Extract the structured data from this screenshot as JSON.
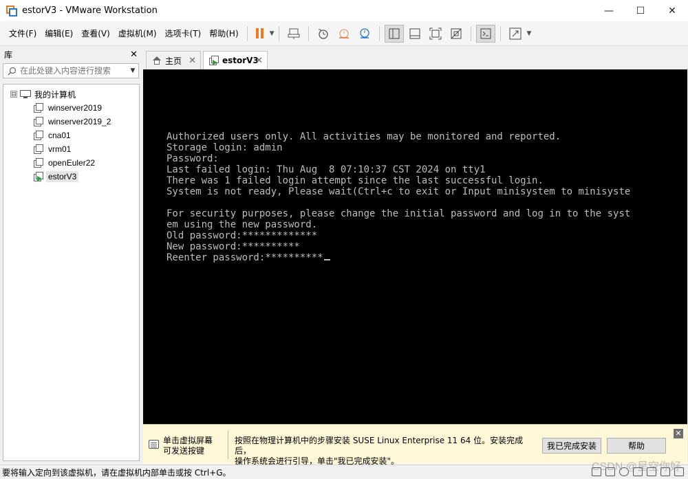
{
  "window": {
    "title": "estorV3 - VMware Workstation",
    "controls": {
      "minimize": "—",
      "maximize": "☐",
      "close": "✕"
    }
  },
  "menu": {
    "items": [
      "文件(F)",
      "编辑(E)",
      "查看(V)",
      "虚拟机(M)",
      "选项卡(T)",
      "帮助(H)"
    ]
  },
  "toolbar": {
    "pause_color": "#f07a1c",
    "icons": [
      "send-ctrl-alt-del-icon",
      "snapshot-icon",
      "revert-snapshot-icon",
      "snapshot-manager-icon",
      "library-view-icon",
      "thumbnail-bar-icon",
      "fullscreen-icon",
      "unity-icon",
      "console-view-icon",
      "stretch-guest-icon"
    ]
  },
  "library": {
    "title": "库",
    "close": "✕",
    "search_placeholder": "在此处键入内容进行搜索",
    "root": {
      "label": "我的计算机",
      "expander": "⊟"
    },
    "vms": [
      {
        "label": "winserver2019"
      },
      {
        "label": "winserver2019_2"
      },
      {
        "label": "cna01"
      },
      {
        "label": "vrm01"
      },
      {
        "label": "openEuler22"
      },
      {
        "label": "estorV3",
        "selected": true,
        "running": true
      }
    ]
  },
  "tabs": [
    {
      "label": "主页",
      "close": "✕"
    },
    {
      "label": "estorV3",
      "close": "✕",
      "active": true
    }
  ],
  "console": {
    "text_color": "#bdbdbd",
    "lines": [
      "Authorized users only. All activities may be monitored and reported.",
      "Storage login: admin",
      "Password:",
      "Last failed login: Thu Aug  8 07:10:37 CST 2024 on tty1",
      "There was 1 failed login attempt since the last successful login.",
      "System is not ready, Please wait(Ctrl+c to exit or Input minisystem to minisyste",
      "",
      "For security purposes, please change the initial password and log in to the syst",
      "em using the new password.",
      "Old password:*************",
      "New password:**********",
      "Reenter password:**********"
    ]
  },
  "install_bar": {
    "hint_line1": "单击虚拟屏幕",
    "hint_line2": "可发送按键",
    "message_line1": "按照在物理计算机中的步骤安装 SUSE Linux Enterprise 11 64 位。安装完成后，",
    "message_line2": "操作系统会进行引导，单击\"我已完成安装\"。",
    "done_button": "我已完成安装",
    "help_button": "帮助",
    "close": "✕"
  },
  "status_bar": {
    "text": "要将输入定向到该虚拟机，请在虚拟机内部单击或按 Ctrl+G。"
  },
  "watermark": "CSDN @星空你好"
}
